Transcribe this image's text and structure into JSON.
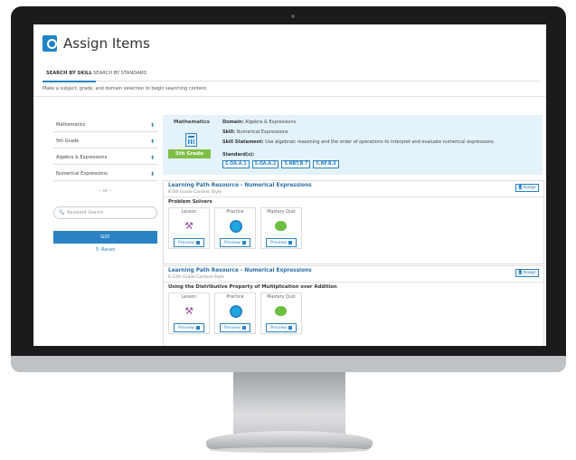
{
  "app": {
    "title": "Assign Items"
  },
  "tabs": {
    "by_skill": "SEARCH BY SKILL",
    "by_standard": "SEARCH BY STANDARD"
  },
  "instruction": "Make a subject, grade, and domain selection to begin searching content.",
  "filters": {
    "subject": "Mathematics",
    "grade": "5th Grade",
    "domain": "Algebra & Expressions",
    "skill": "Numerical Expressions",
    "or_divider": "-- or --",
    "keyword_placeholder": "Keyword Search",
    "go_label": "GO!",
    "reset_label": "Reset"
  },
  "skill_info": {
    "subject": "Mathematics",
    "grade_badge": "5th Grade",
    "domain_label": "Domain:",
    "domain_value": "Algebra & Expressions",
    "skill_label": "Skill:",
    "skill_value": "Numerical Expressions",
    "statement_label": "Skill Statement:",
    "statement_value": "Use algebraic reasoning and the order of operations to interpret and evaluate numerical expressions.",
    "standards_label": "Standard(s):",
    "standards": [
      "5.OA.A.1",
      "5.OA.A.2",
      "5.NBT.B.7",
      "5.NF.B.6"
    ]
  },
  "results": [
    {
      "title": "Learning Path Resource - Numerical Expressions",
      "subtitle": "K-5th Grade Content Style",
      "assign_label": "Assign",
      "group": "Problem Solvers",
      "tiles": [
        {
          "label": "Lesson",
          "icon": "lesson-icon",
          "preview": "Preview"
        },
        {
          "label": "Practice",
          "icon": "practice-icon",
          "preview": "Preview"
        },
        {
          "label": "Mastery Quiz",
          "icon": "mastery-quiz-icon",
          "preview": "Preview"
        }
      ]
    },
    {
      "title": "Learning Path Resource - Numerical Expressions",
      "subtitle": "6-12th Grade Content Style",
      "assign_label": "Assign",
      "group": "Using the Distributive Property of Multiplication over Addition",
      "tiles": [
        {
          "label": "Lesson",
          "icon": "lesson-icon",
          "preview": "Preview"
        },
        {
          "label": "Practice",
          "icon": "practice-icon",
          "preview": "Preview"
        },
        {
          "label": "Mastery Quiz",
          "icon": "mastery-quiz-icon",
          "preview": "Preview"
        }
      ]
    }
  ],
  "colors": {
    "accent": "#2a82c4",
    "grade_badge": "#7fbf45",
    "skill_bg": "#e4f2fa",
    "bezel": "#1b1b1b"
  }
}
